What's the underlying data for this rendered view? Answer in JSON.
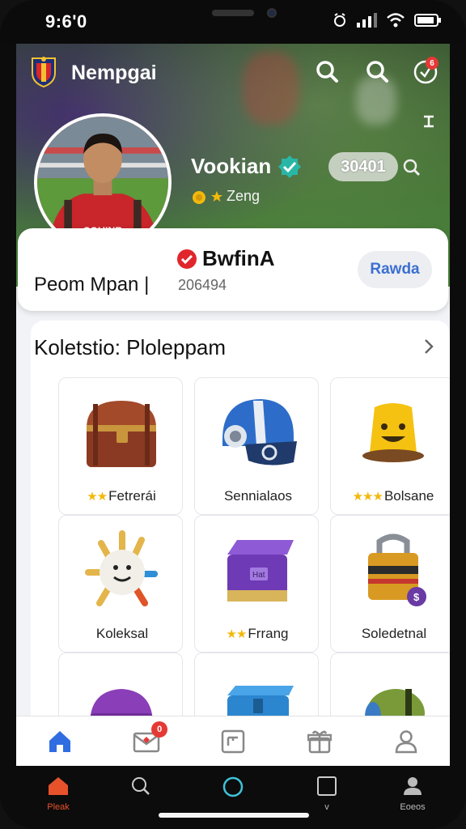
{
  "status_bar": {
    "time": "9:6'0"
  },
  "header": {
    "app_title": "Nempgai",
    "notification_count": "6"
  },
  "profile": {
    "name": "Vookian",
    "id_pill": "30401",
    "rank_label": "Zeng",
    "player_name": "Peom Mpan |",
    "club_name": "BwfinA",
    "club_number": "206494",
    "action_button": "Rawda"
  },
  "collection": {
    "title": "Koletstio: Ploleppam",
    "items": [
      {
        "label": "Fetrerái",
        "stars": "★★",
        "icon": "treasure-chest-icon"
      },
      {
        "label": "Sennialaos",
        "stars": "",
        "icon": "helmet-icon"
      },
      {
        "label": "Bolsane",
        "stars": "★★★",
        "icon": "yellow-cup-icon"
      },
      {
        "label": "Koleksal",
        "stars": "",
        "icon": "spiky-ball-icon"
      },
      {
        "label": "Frrang",
        "stars": "★★",
        "icon": "purple-crate-icon"
      },
      {
        "label": "Soledetnal",
        "stars": "",
        "icon": "padlock-icon"
      },
      {
        "label": "",
        "stars": "",
        "icon": "purple-case-icon"
      },
      {
        "label": "",
        "stars": "",
        "icon": "blue-crate-icon"
      },
      {
        "label": "",
        "stars": "",
        "icon": "green-canister-icon"
      }
    ]
  },
  "tab_bar": {
    "tabs": [
      {
        "icon": "home-icon",
        "active": true
      },
      {
        "icon": "mail-icon",
        "badge": "0"
      },
      {
        "icon": "calendar-icon"
      },
      {
        "icon": "gift-icon"
      },
      {
        "icon": "profile-icon"
      }
    ]
  },
  "system_nav": {
    "items": [
      {
        "label": "Pleak",
        "icon": "home-icon"
      },
      {
        "label": "",
        "icon": "search-icon"
      },
      {
        "label": "",
        "icon": "circle-icon"
      },
      {
        "label": "v",
        "icon": "square-icon"
      },
      {
        "label": "Eoeos",
        "icon": "person-icon"
      }
    ]
  },
  "colors": {
    "accent_blue": "#2f6de1",
    "badge_red": "#e53935",
    "star_yellow": "#f2b90c",
    "card_button_text": "#3b6fd1"
  }
}
